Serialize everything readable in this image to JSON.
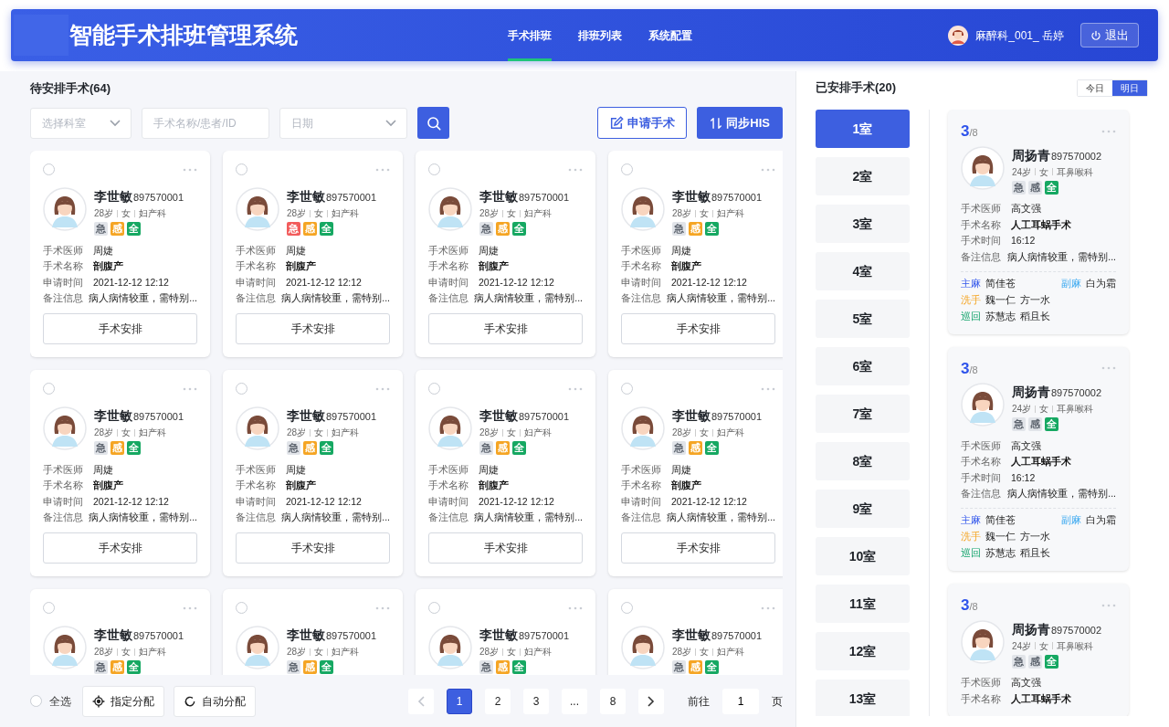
{
  "header": {
    "title": "智能手术排班管理系统",
    "nav": [
      {
        "label": "手术排班",
        "selected": true
      },
      {
        "label": "排班列表",
        "selected": false
      },
      {
        "label": "系统配置",
        "selected": false
      }
    ],
    "user": "麻醉科_001_ 岳婷",
    "logout": "退出"
  },
  "pending": {
    "title": "待安排手术(64)",
    "filters": {
      "department": {
        "placeholder": "选择科室"
      },
      "search": {
        "placeholder": "手术名称/患者/ID"
      },
      "date": {
        "placeholder": "日期"
      }
    },
    "buttons": {
      "apply": "申请手术",
      "sync": "同步HIS"
    },
    "cards": [
      {
        "checked": false,
        "name": "李世敏",
        "id": "897570001",
        "age": "28岁",
        "sex": "女",
        "dept": "妇产科",
        "tags": [
          {
            "label": "急",
            "kind": "urgent",
            "on": false
          },
          {
            "label": "感",
            "kind": "infection",
            "on": true
          },
          {
            "label": "全",
            "kind": "full",
            "on": true
          }
        ],
        "fields": [
          {
            "label": "手术医师",
            "value": "周婕",
            "bold": false
          },
          {
            "label": "手术名称",
            "value": "剖腹产",
            "bold": true
          },
          {
            "label": "申请时间",
            "value": "2021-12-12 12:12",
            "bold": false
          },
          {
            "label": "备注信息",
            "value": "病人病情较重，需特别...",
            "bold": false
          }
        ],
        "action": "手术安排"
      },
      {
        "checked": false,
        "name": "李世敏",
        "id": "897570001",
        "age": "28岁",
        "sex": "女",
        "dept": "妇产科",
        "tags": [
          {
            "label": "急",
            "kind": "urgent",
            "on": true
          },
          {
            "label": "感",
            "kind": "infection",
            "on": true
          },
          {
            "label": "全",
            "kind": "full",
            "on": true
          }
        ],
        "fields": [
          {
            "label": "手术医师",
            "value": "周婕",
            "bold": false
          },
          {
            "label": "手术名称",
            "value": "剖腹产",
            "bold": true
          },
          {
            "label": "申请时间",
            "value": "2021-12-12 12:12",
            "bold": false
          },
          {
            "label": "备注信息",
            "value": "病人病情较重，需特别...",
            "bold": false
          }
        ],
        "action": "手术安排"
      },
      {
        "checked": false,
        "name": "李世敏",
        "id": "897570001",
        "age": "28岁",
        "sex": "女",
        "dept": "妇产科",
        "tags": [
          {
            "label": "急",
            "kind": "urgent",
            "on": false
          },
          {
            "label": "感",
            "kind": "infection",
            "on": true
          },
          {
            "label": "全",
            "kind": "full",
            "on": true
          }
        ],
        "fields": [
          {
            "label": "手术医师",
            "value": "周婕",
            "bold": false
          },
          {
            "label": "手术名称",
            "value": "剖腹产",
            "bold": true
          },
          {
            "label": "申请时间",
            "value": "2021-12-12 12:12",
            "bold": false
          },
          {
            "label": "备注信息",
            "value": "病人病情较重，需特别...",
            "bold": false
          }
        ],
        "action": "手术安排"
      },
      {
        "checked": false,
        "name": "李世敏",
        "id": "897570001",
        "age": "28岁",
        "sex": "女",
        "dept": "妇产科",
        "tags": [
          {
            "label": "急",
            "kind": "urgent",
            "on": false
          },
          {
            "label": "感",
            "kind": "infection",
            "on": true
          },
          {
            "label": "全",
            "kind": "full",
            "on": true
          }
        ],
        "fields": [
          {
            "label": "手术医师",
            "value": "周婕",
            "bold": false
          },
          {
            "label": "手术名称",
            "value": "剖腹产",
            "bold": true
          },
          {
            "label": "申请时间",
            "value": "2021-12-12 12:12",
            "bold": false
          },
          {
            "label": "备注信息",
            "value": "病人病情较重，需特别...",
            "bold": false
          }
        ],
        "action": "手术安排"
      },
      {
        "checked": false,
        "name": "李世敏",
        "id": "897570001",
        "age": "28岁",
        "sex": "女",
        "dept": "妇产科",
        "tags": [
          {
            "label": "急",
            "kind": "urgent",
            "on": false
          },
          {
            "label": "感",
            "kind": "infection",
            "on": true
          },
          {
            "label": "全",
            "kind": "full",
            "on": true
          }
        ],
        "fields": [
          {
            "label": "手术医师",
            "value": "周婕",
            "bold": false
          },
          {
            "label": "手术名称",
            "value": "剖腹产",
            "bold": true
          },
          {
            "label": "申请时间",
            "value": "2021-12-12 12:12",
            "bold": false
          },
          {
            "label": "备注信息",
            "value": "病人病情较重，需特别...",
            "bold": false
          }
        ],
        "action": "手术安排"
      },
      {
        "checked": false,
        "name": "李世敏",
        "id": "897570001",
        "age": "28岁",
        "sex": "女",
        "dept": "妇产科",
        "tags": [
          {
            "label": "急",
            "kind": "urgent",
            "on": false
          },
          {
            "label": "感",
            "kind": "infection",
            "on": true
          },
          {
            "label": "全",
            "kind": "full",
            "on": true
          }
        ],
        "fields": [
          {
            "label": "手术医师",
            "value": "周婕",
            "bold": false
          },
          {
            "label": "手术名称",
            "value": "剖腹产",
            "bold": true
          },
          {
            "label": "申请时间",
            "value": "2021-12-12 12:12",
            "bold": false
          },
          {
            "label": "备注信息",
            "value": "病人病情较重，需特别...",
            "bold": false
          }
        ],
        "action": "手术安排"
      },
      {
        "checked": false,
        "name": "李世敏",
        "id": "897570001",
        "age": "28岁",
        "sex": "女",
        "dept": "妇产科",
        "tags": [
          {
            "label": "急",
            "kind": "urgent",
            "on": false
          },
          {
            "label": "感",
            "kind": "infection",
            "on": true
          },
          {
            "label": "全",
            "kind": "full",
            "on": true
          }
        ],
        "fields": [
          {
            "label": "手术医师",
            "value": "周婕",
            "bold": false
          },
          {
            "label": "手术名称",
            "value": "剖腹产",
            "bold": true
          },
          {
            "label": "申请时间",
            "value": "2021-12-12 12:12",
            "bold": false
          },
          {
            "label": "备注信息",
            "value": "病人病情较重，需特别...",
            "bold": false
          }
        ],
        "action": "手术安排"
      },
      {
        "checked": false,
        "name": "李世敏",
        "id": "897570001",
        "age": "28岁",
        "sex": "女",
        "dept": "妇产科",
        "tags": [
          {
            "label": "急",
            "kind": "urgent",
            "on": false
          },
          {
            "label": "感",
            "kind": "infection",
            "on": true
          },
          {
            "label": "全",
            "kind": "full",
            "on": true
          }
        ],
        "fields": [
          {
            "label": "手术医师",
            "value": "周婕",
            "bold": false
          },
          {
            "label": "手术名称",
            "value": "剖腹产",
            "bold": true
          },
          {
            "label": "申请时间",
            "value": "2021-12-12 12:12",
            "bold": false
          },
          {
            "label": "备注信息",
            "value": "病人病情较重，需特别...",
            "bold": false
          }
        ],
        "action": "手术安排"
      },
      {
        "checked": false,
        "name": "李世敏",
        "id": "897570001",
        "age": "28岁",
        "sex": "女",
        "dept": "妇产科",
        "tags": [
          {
            "label": "急",
            "kind": "urgent",
            "on": false
          },
          {
            "label": "感",
            "kind": "infection",
            "on": true
          },
          {
            "label": "全",
            "kind": "full",
            "on": true
          }
        ]
      },
      {
        "checked": false,
        "name": "李世敏",
        "id": "897570001",
        "age": "28岁",
        "sex": "女",
        "dept": "妇产科",
        "tags": [
          {
            "label": "急",
            "kind": "urgent",
            "on": false
          },
          {
            "label": "感",
            "kind": "infection",
            "on": true
          },
          {
            "label": "全",
            "kind": "full",
            "on": true
          }
        ]
      },
      {
        "checked": false,
        "name": "李世敏",
        "id": "897570001",
        "age": "28岁",
        "sex": "女",
        "dept": "妇产科",
        "tags": [
          {
            "label": "急",
            "kind": "urgent",
            "on": false
          },
          {
            "label": "感",
            "kind": "infection",
            "on": true
          },
          {
            "label": "全",
            "kind": "full",
            "on": true
          }
        ]
      },
      {
        "checked": false,
        "name": "李世敏",
        "id": "897570001",
        "age": "28岁",
        "sex": "女",
        "dept": "妇产科",
        "tags": [
          {
            "label": "急",
            "kind": "urgent",
            "on": false
          },
          {
            "label": "感",
            "kind": "infection",
            "on": true
          },
          {
            "label": "全",
            "kind": "full",
            "on": true
          }
        ]
      }
    ],
    "footer": {
      "select_all": {
        "label": "全选",
        "checked": false
      },
      "assign": "指定分配",
      "auto_assign": "自动分配",
      "pages": [
        {
          "label": "1",
          "selected": true
        },
        {
          "label": "2",
          "selected": false
        },
        {
          "label": "3",
          "selected": false
        },
        {
          "label": "...",
          "selected": false
        },
        {
          "label": "8",
          "selected": false
        }
      ],
      "goto": {
        "prefix": "前往",
        "value": "1",
        "suffix": "页"
      }
    }
  },
  "scheduled": {
    "title": "已安排手术(20)",
    "days": [
      {
        "label": "今日",
        "selected": false
      },
      {
        "label": "明日",
        "selected": true
      }
    ],
    "rooms": [
      {
        "label": "1室",
        "selected": true
      },
      {
        "label": "2室",
        "selected": false
      },
      {
        "label": "3室",
        "selected": false
      },
      {
        "label": "4室",
        "selected": false
      },
      {
        "label": "5室",
        "selected": false
      },
      {
        "label": "6室",
        "selected": false
      },
      {
        "label": "7室",
        "selected": false
      },
      {
        "label": "8室",
        "selected": false
      },
      {
        "label": "9室",
        "selected": false
      },
      {
        "label": "10室",
        "selected": false
      },
      {
        "label": "11室",
        "selected": false
      },
      {
        "label": "12室",
        "selected": false
      },
      {
        "label": "13室",
        "selected": false
      }
    ],
    "cards": [
      {
        "count": "3",
        "total": "/8",
        "name": "周扬青",
        "id": "897570002",
        "age": "24岁",
        "sex": "女",
        "dept": "耳鼻喉科",
        "tags": [
          {
            "label": "急",
            "kind": "urgent",
            "on": false
          },
          {
            "label": "感",
            "kind": "infection",
            "on": false
          },
          {
            "label": "全",
            "kind": "full",
            "on": true
          }
        ],
        "fields": [
          {
            "label": "手术医师",
            "value": "高文强",
            "bold": false
          },
          {
            "label": "手术名称",
            "value": "人工耳蜗手术",
            "bold": true
          },
          {
            "label": "手术时间",
            "value": "16:12",
            "bold": false
          },
          {
            "label": "备注信息",
            "value": "病人病情较重，需特别...",
            "bold": false
          }
        ],
        "staff_rows": [
          [
            {
              "role": "主麻",
              "kind": "main",
              "names": [
                "简佳苍"
              ]
            },
            {
              "role": "副麻",
              "kind": "assist",
              "names": [
                "白为霜"
              ]
            }
          ],
          [
            {
              "role": "洗手",
              "kind": "scrub",
              "names": [
                "魏一仁",
                "方一水"
              ]
            }
          ],
          [
            {
              "role": "巡回",
              "kind": "circulating",
              "names": [
                "苏慧志",
                "稻且长"
              ]
            }
          ]
        ]
      },
      {
        "count": "3",
        "total": "/8",
        "name": "周扬青",
        "id": "897570002",
        "age": "24岁",
        "sex": "女",
        "dept": "耳鼻喉科",
        "tags": [
          {
            "label": "急",
            "kind": "urgent",
            "on": false
          },
          {
            "label": "感",
            "kind": "infection",
            "on": false
          },
          {
            "label": "全",
            "kind": "full",
            "on": true
          }
        ],
        "fields": [
          {
            "label": "手术医师",
            "value": "高文强",
            "bold": false
          },
          {
            "label": "手术名称",
            "value": "人工耳蜗手术",
            "bold": true
          },
          {
            "label": "手术时间",
            "value": "16:12",
            "bold": false
          },
          {
            "label": "备注信息",
            "value": "病人病情较重，需特别...",
            "bold": false
          }
        ],
        "staff_rows": [
          [
            {
              "role": "主麻",
              "kind": "main",
              "names": [
                "简佳苍"
              ]
            },
            {
              "role": "副麻",
              "kind": "assist",
              "names": [
                "白为霜"
              ]
            }
          ],
          [
            {
              "role": "洗手",
              "kind": "scrub",
              "names": [
                "魏一仁",
                "方一水"
              ]
            }
          ],
          [
            {
              "role": "巡回",
              "kind": "circulating",
              "names": [
                "苏慧志",
                "稻且长"
              ]
            }
          ]
        ]
      },
      {
        "count": "3",
        "total": "/8",
        "name": "周扬青",
        "id": "897570002",
        "age": "24岁",
        "sex": "女",
        "dept": "耳鼻喉科",
        "tags": [
          {
            "label": "急",
            "kind": "urgent",
            "on": false
          },
          {
            "label": "感",
            "kind": "infection",
            "on": false
          },
          {
            "label": "全",
            "kind": "full",
            "on": true
          }
        ],
        "fields": [
          {
            "label": "手术医师",
            "value": "高文强",
            "bold": false
          },
          {
            "label": "手术名称",
            "value": "人工耳蜗手术",
            "bold": true
          }
        ]
      }
    ]
  }
}
